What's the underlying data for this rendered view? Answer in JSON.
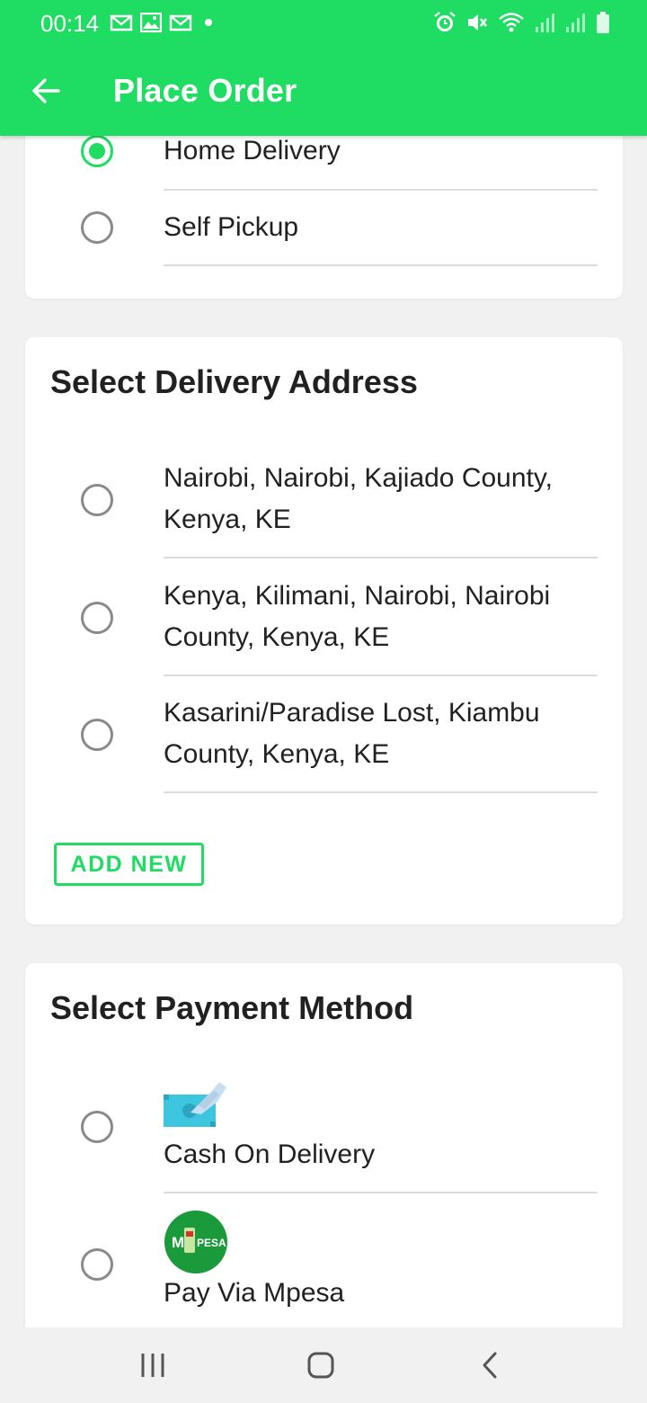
{
  "status_bar": {
    "time": "00:14",
    "left_icons": [
      "gmail-icon",
      "image-icon",
      "gmail-icon",
      "dot-icon"
    ],
    "right_icons": [
      "alarm-icon",
      "mute-icon",
      "wifi-icon",
      "signal-icon",
      "signal-icon",
      "battery-icon"
    ]
  },
  "app_bar": {
    "title": "Place Order",
    "back_icon": "arrow-left-icon"
  },
  "delivery_type": {
    "options": [
      {
        "label": "Home Delivery",
        "selected": true
      },
      {
        "label": "Self Pickup",
        "selected": false
      }
    ]
  },
  "address_card": {
    "title": "Select Delivery Address",
    "addresses": [
      {
        "line1": "Nairobi, Nairobi, Kajiado County,",
        "line2": "Kenya, KE",
        "selected": false
      },
      {
        "line1": "Kenya, Kilimani, Nairobi, Nairobi",
        "line2": "County, Kenya, KE",
        "selected": false
      },
      {
        "line1": "Kasarini/Paradise Lost, Kiambu",
        "line2": "County, Kenya, KE",
        "selected": false
      }
    ],
    "add_new_label": "ADD NEW"
  },
  "payment_card": {
    "title": "Select Payment Method",
    "methods": [
      {
        "label": "Cash On Delivery",
        "icon": "cash-icon",
        "selected": false
      },
      {
        "label": "Pay Via Mpesa",
        "icon": "mpesa-logo",
        "logo_text_left": "M",
        "logo_text_right": "PESA",
        "selected": false
      }
    ]
  },
  "nav_bar": {
    "buttons": [
      "recent-apps-icon",
      "home-icon",
      "back-icon"
    ]
  },
  "colors": {
    "accent": "#1fdc63",
    "mpesa": "#1b9a3c",
    "cash": "#3ec6e0"
  }
}
